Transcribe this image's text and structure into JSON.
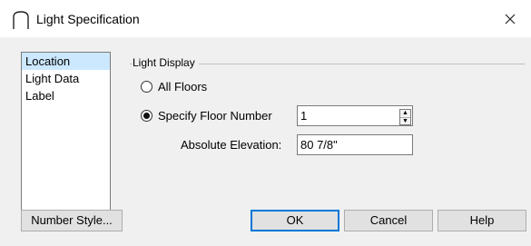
{
  "window": {
    "title": "Light Specification"
  },
  "nav": {
    "items": [
      "Location",
      "Light Data",
      "Label"
    ],
    "selected": 0
  },
  "light_display": {
    "group_label": "Light Display",
    "all_floors_label": "All Floors",
    "specify_floor_label": "Specify Floor Number",
    "selected_option": "specify_floor",
    "floor_number": "1",
    "elevation_label": "Absolute Elevation:",
    "elevation_value": "80 7/8\""
  },
  "buttons": {
    "number_style": "Number Style...",
    "ok": "OK",
    "cancel": "Cancel",
    "help": "Help"
  },
  "icons": {
    "title": "chief-arch-icon",
    "close": "close-icon",
    "spin_up": "spin-up-icon",
    "spin_down": "spin-down-icon"
  }
}
